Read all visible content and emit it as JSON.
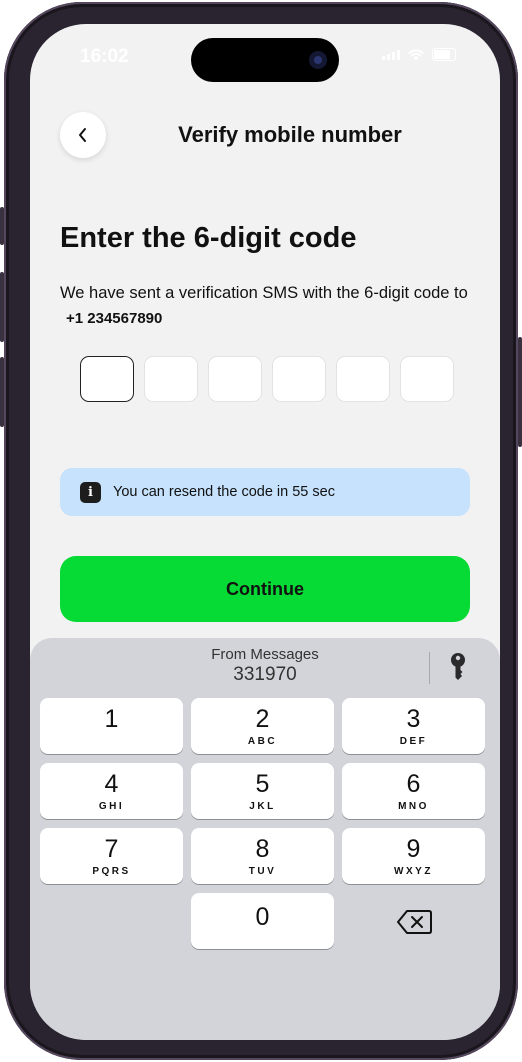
{
  "status_bar": {
    "time": "16:02"
  },
  "header": {
    "title": "Verify mobile number"
  },
  "main": {
    "heading": "Enter the 6-digit code",
    "description": "We have sent a verification SMS with the 6-digit code to",
    "phone_number": "+1 234567890",
    "otp_digits": [
      "",
      "",
      "",
      "",
      "",
      ""
    ],
    "info_text": "You can resend the code in 55 sec",
    "continue_label": "Continue"
  },
  "keyboard": {
    "suggestion_label": "From Messages",
    "suggestion_code": "331970",
    "keys": [
      {
        "digit": "1",
        "letters": ""
      },
      {
        "digit": "2",
        "letters": "ABC"
      },
      {
        "digit": "3",
        "letters": "DEF"
      },
      {
        "digit": "4",
        "letters": "GHI"
      },
      {
        "digit": "5",
        "letters": "JKL"
      },
      {
        "digit": "6",
        "letters": "MNO"
      },
      {
        "digit": "7",
        "letters": "PQRS"
      },
      {
        "digit": "8",
        "letters": "TUV"
      },
      {
        "digit": "9",
        "letters": "WXYZ"
      },
      {
        "digit": "0",
        "letters": ""
      }
    ]
  },
  "colors": {
    "accent_green": "#06da34",
    "info_background": "#c6e2fc",
    "screen_background": "#f2f2f2",
    "keyboard_background": "#d2d4da"
  }
}
